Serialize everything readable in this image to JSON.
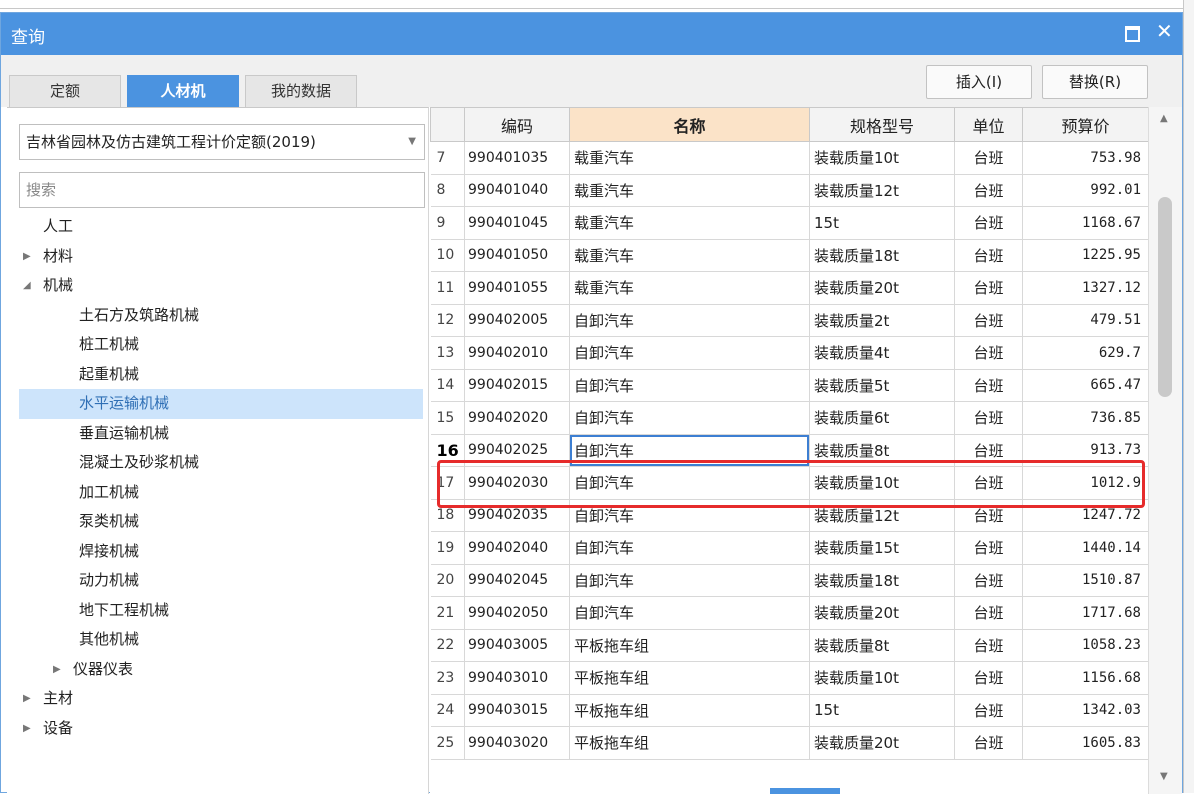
{
  "window": {
    "title": "查询"
  },
  "tabs": [
    {
      "label": "定额",
      "active": false
    },
    {
      "label": "人材机",
      "active": true
    },
    {
      "label": "我的数据",
      "active": false
    }
  ],
  "buttons": {
    "insert": "插入(I)",
    "replace": "替换(R)"
  },
  "library": {
    "selected": "吉林省园林及仿古建筑工程计价定额(2019)"
  },
  "search": {
    "placeholder": "搜索",
    "value": ""
  },
  "tree": [
    {
      "label": "人工",
      "level": 1,
      "toggle": ""
    },
    {
      "label": "材料",
      "level": 1,
      "toggle": "collapsed"
    },
    {
      "label": "机械",
      "level": 1,
      "toggle": "expanded"
    },
    {
      "label": "土石方及筑路机械",
      "level": 2,
      "toggle": ""
    },
    {
      "label": "桩工机械",
      "level": 2,
      "toggle": ""
    },
    {
      "label": "起重机械",
      "level": 2,
      "toggle": ""
    },
    {
      "label": "水平运输机械",
      "level": 2,
      "toggle": "",
      "selected": true
    },
    {
      "label": "垂直运输机械",
      "level": 2,
      "toggle": ""
    },
    {
      "label": "混凝土及砂浆机械",
      "level": 2,
      "toggle": ""
    },
    {
      "label": "加工机械",
      "level": 2,
      "toggle": ""
    },
    {
      "label": "泵类机械",
      "level": 2,
      "toggle": ""
    },
    {
      "label": "焊接机械",
      "level": 2,
      "toggle": ""
    },
    {
      "label": "动力机械",
      "level": 2,
      "toggle": ""
    },
    {
      "label": "地下工程机械",
      "level": 2,
      "toggle": ""
    },
    {
      "label": "其他机械",
      "level": 2,
      "toggle": ""
    },
    {
      "label": "仪器仪表",
      "level": 1.5,
      "toggle": "collapsed"
    },
    {
      "label": "主材",
      "level": 1,
      "toggle": "collapsed"
    },
    {
      "label": "设备",
      "level": 1,
      "toggle": "collapsed"
    }
  ],
  "grid": {
    "columns": [
      "",
      "编码",
      "名称",
      "规格型号",
      "单位",
      "预算价"
    ],
    "sorted_column": "名称",
    "current_row": 16,
    "rows": [
      {
        "num": "7",
        "code": "990401035",
        "name": "载重汽车",
        "spec": "装载质量10t",
        "unit": "台班",
        "price": "753.98"
      },
      {
        "num": "8",
        "code": "990401040",
        "name": "载重汽车",
        "spec": "装载质量12t",
        "unit": "台班",
        "price": "992.01"
      },
      {
        "num": "9",
        "code": "990401045",
        "name": "载重汽车",
        "spec": "15t",
        "unit": "台班",
        "price": "1168.67"
      },
      {
        "num": "10",
        "code": "990401050",
        "name": "载重汽车",
        "spec": "装载质量18t",
        "unit": "台班",
        "price": "1225.95"
      },
      {
        "num": "11",
        "code": "990401055",
        "name": "载重汽车",
        "spec": "装载质量20t",
        "unit": "台班",
        "price": "1327.12"
      },
      {
        "num": "12",
        "code": "990402005",
        "name": "自卸汽车",
        "spec": "装载质量2t",
        "unit": "台班",
        "price": "479.51"
      },
      {
        "num": "13",
        "code": "990402010",
        "name": "自卸汽车",
        "spec": "装载质量4t",
        "unit": "台班",
        "price": "629.7"
      },
      {
        "num": "14",
        "code": "990402015",
        "name": "自卸汽车",
        "spec": "装载质量5t",
        "unit": "台班",
        "price": "665.47"
      },
      {
        "num": "15",
        "code": "990402020",
        "name": "自卸汽车",
        "spec": "装载质量6t",
        "unit": "台班",
        "price": "736.85"
      },
      {
        "num": "16",
        "code": "990402025",
        "name": "自卸汽车",
        "spec": "装载质量8t",
        "unit": "台班",
        "price": "913.73"
      },
      {
        "num": "17",
        "code": "990402030",
        "name": "自卸汽车",
        "spec": "装载质量10t",
        "unit": "台班",
        "price": "1012.9"
      },
      {
        "num": "18",
        "code": "990402035",
        "name": "自卸汽车",
        "spec": "装载质量12t",
        "unit": "台班",
        "price": "1247.72"
      },
      {
        "num": "19",
        "code": "990402040",
        "name": "自卸汽车",
        "spec": "装载质量15t",
        "unit": "台班",
        "price": "1440.14"
      },
      {
        "num": "20",
        "code": "990402045",
        "name": "自卸汽车",
        "spec": "装载质量18t",
        "unit": "台班",
        "price": "1510.87"
      },
      {
        "num": "21",
        "code": "990402050",
        "name": "自卸汽车",
        "spec": "装载质量20t",
        "unit": "台班",
        "price": "1717.68"
      },
      {
        "num": "22",
        "code": "990403005",
        "name": "平板拖车组",
        "spec": "装载质量8t",
        "unit": "台班",
        "price": "1058.23"
      },
      {
        "num": "23",
        "code": "990403010",
        "name": "平板拖车组",
        "spec": "装载质量10t",
        "unit": "台班",
        "price": "1156.68"
      },
      {
        "num": "24",
        "code": "990403015",
        "name": "平板拖车组",
        "spec": "15t",
        "unit": "台班",
        "price": "1342.03"
      },
      {
        "num": "25",
        "code": "990403020",
        "name": "平板拖车组",
        "spec": "装载质量20t",
        "unit": "台班",
        "price": "1605.83"
      }
    ]
  },
  "colors": {
    "accent": "#4b93e0",
    "highlight_border": "#e62b2b",
    "sorted_header": "#fbe3c8",
    "tree_selected": "#cde4fb"
  }
}
